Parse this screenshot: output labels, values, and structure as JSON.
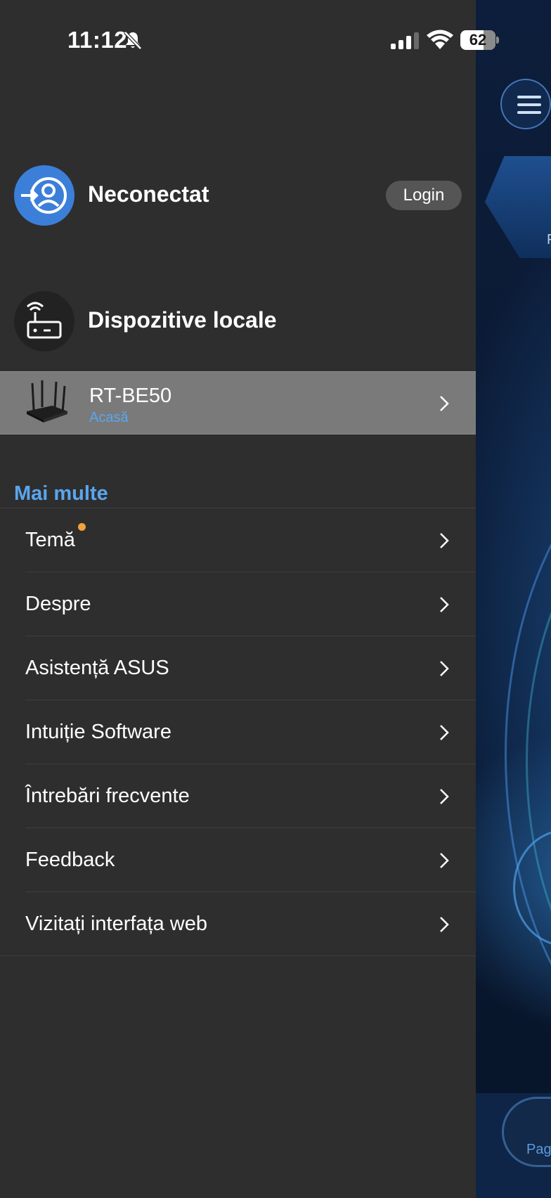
{
  "status_bar": {
    "time": "11:12",
    "battery": "62"
  },
  "account": {
    "status": "Neconectat",
    "login_label": "Login"
  },
  "local_devices": {
    "title": "Dispozitive locale",
    "devices": [
      {
        "name": "RT-BE50",
        "location": "Acasă"
      }
    ]
  },
  "more": {
    "title": "Mai multe",
    "items": [
      {
        "label": "Temă",
        "has_new_dot": true
      },
      {
        "label": "Despre"
      },
      {
        "label": "Asistență ASUS"
      },
      {
        "label": "Intuiție Software"
      },
      {
        "label": "Întrebări frecvente"
      },
      {
        "label": "Feedback"
      },
      {
        "label": "Vizitați interfața web"
      }
    ]
  },
  "background_app": {
    "tab_label_partial": "Pag",
    "hex_label_partial": "F"
  },
  "colors": {
    "drawer_bg": "#2e2e2e",
    "accent_blue": "#5aa6ee",
    "avatar_blue": "#3b7fd9",
    "selected_row": "#7a7a7a",
    "new_dot": "#f2a33a"
  }
}
